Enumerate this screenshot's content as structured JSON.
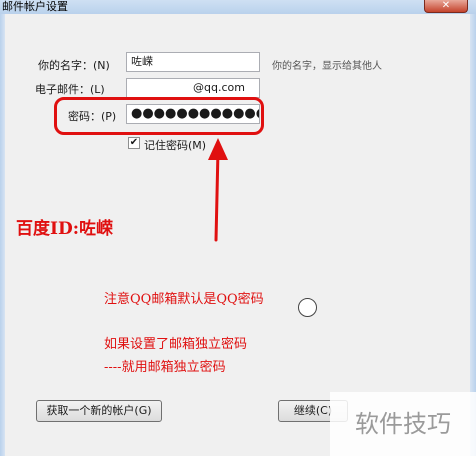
{
  "window": {
    "title": "邮件帐户设置",
    "close_glyph": "✕"
  },
  "form": {
    "name_label": "你的名字：(N)",
    "name_value": "咗嵘",
    "name_hint": "你的名字，显示给其他人",
    "email_label": "电子邮件：(L)",
    "email_value": "@qq.com",
    "password_label": "密码：(P)",
    "password_value": "●●●●●●●●●●●●●●",
    "remember_label": "记住密码(M)",
    "remember_checked": "✔"
  },
  "annotations": {
    "baidu_id": "百度ID:咗嵘",
    "note1": "注意QQ邮箱默认是QQ密码",
    "note2": "如果设置了邮箱独立密码",
    "note3": "----就用邮箱独立密码",
    "color": "#e01010"
  },
  "buttons": {
    "new_account": "获取一个新的帐户(G)",
    "continue": "继续(C)"
  },
  "watermark": "软件技巧"
}
